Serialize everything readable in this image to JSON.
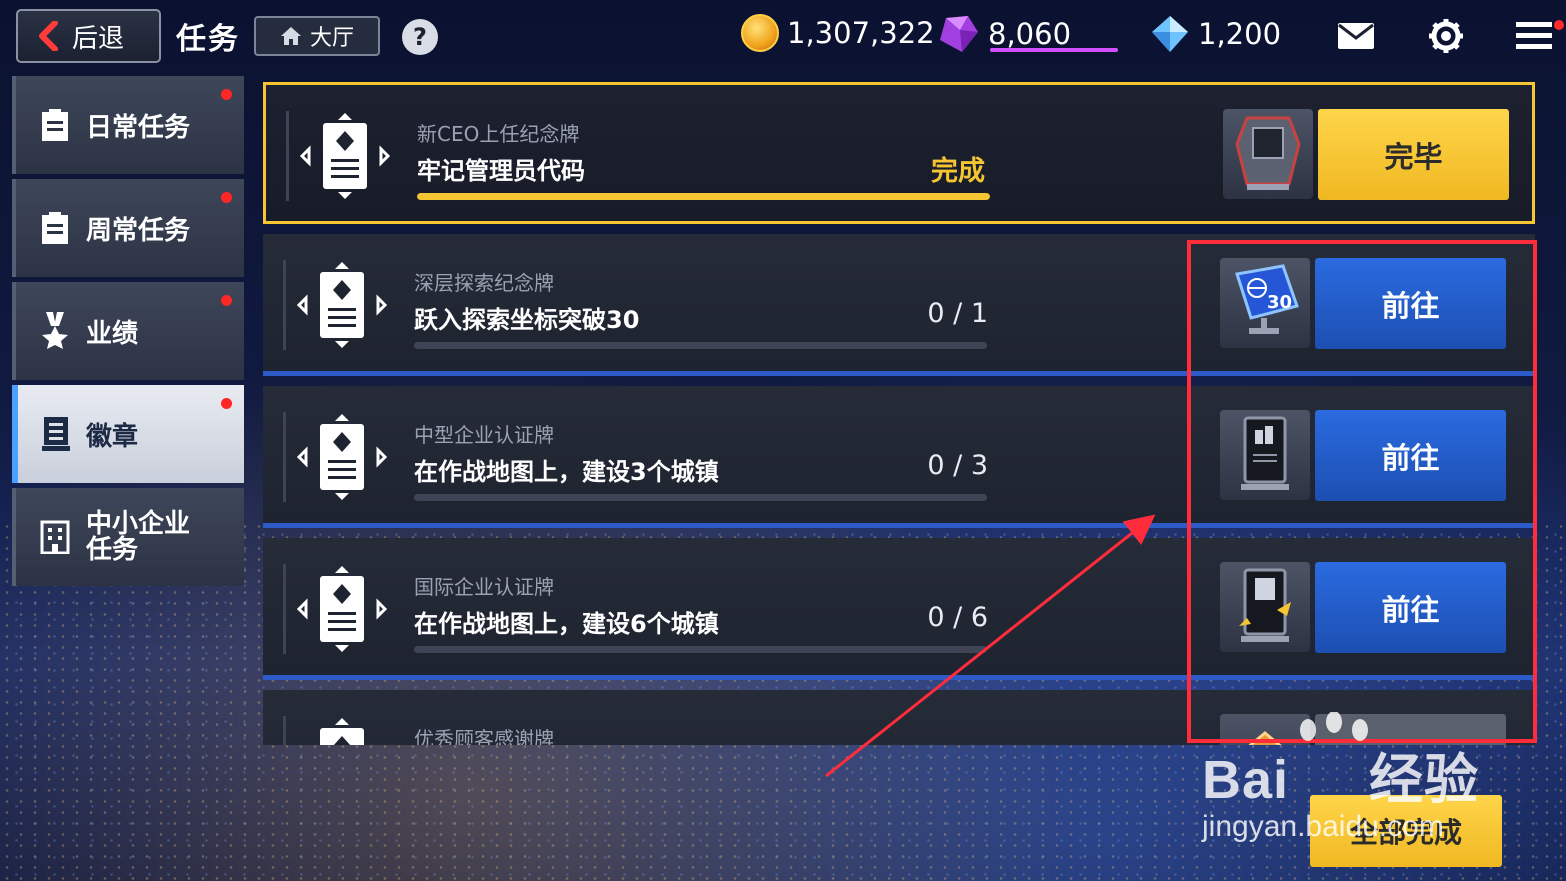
{
  "header": {
    "back_label": "后退",
    "title": "任务",
    "lobby_label": "大厅",
    "help_label": "?"
  },
  "currencies": {
    "gold": "1,307,322",
    "gems": "8,060",
    "diamonds": "1,200",
    "gold_icon": "gold-coin-icon",
    "gem_icon": "purple-gem-icon",
    "diamond_icon": "blue-diamond-icon"
  },
  "sidebar": {
    "items": [
      {
        "label": "日常任务",
        "icon": "clipboard-icon",
        "has_alert": true,
        "active": false
      },
      {
        "label": "周常任务",
        "icon": "clipboard-icon",
        "has_alert": true,
        "active": false
      },
      {
        "label": "业绩",
        "icon": "medal-icon",
        "has_alert": true,
        "active": false
      },
      {
        "label": "徽章",
        "icon": "badge-icon",
        "has_alert": true,
        "active": true
      },
      {
        "label_line1": "中小企业",
        "label_line2": "任务",
        "icon": "building-icon",
        "has_alert": false,
        "active": false
      }
    ]
  },
  "quests": [
    {
      "subtitle": "新CEO上任纪念牌",
      "title": "牢记管理员代码",
      "progress_text": "完成",
      "progress": 1.0,
      "action": "完毕",
      "state": "done",
      "badge_icon": "trophy-badge-icon"
    },
    {
      "subtitle": "深层探索纪念牌",
      "title": "跃入探索坐标突破30",
      "progress_text": "0 / 1",
      "progress": 0.0,
      "action": "前往",
      "state": "go",
      "badge_icon": "globe-30-badge-icon",
      "badge_text": "30"
    },
    {
      "subtitle": "中型企业认证牌",
      "title": "在作战地图上，建设3个城镇",
      "progress_text": "0 / 3",
      "progress": 0.0,
      "action": "前往",
      "state": "go",
      "badge_icon": "medium-company-plaque-icon"
    },
    {
      "subtitle": "国际企业认证牌",
      "title": "在作战地图上，建设6个城镇",
      "progress_text": "0 / 6",
      "progress": 0.0,
      "action": "前往",
      "state": "go",
      "badge_icon": "international-company-plaque-icon"
    },
    {
      "subtitle": "优秀顾客感谢牌",
      "title": "",
      "progress_text": "",
      "progress": 0.0,
      "action": "",
      "state": "partial",
      "badge_icon": "gold-plaque-icon"
    }
  ],
  "footer": {
    "complete_all_label": "全部完成"
  },
  "watermark": {
    "brand": "Bai",
    "brand_suffix": "经验",
    "url": "jingyan.baidu.com"
  },
  "colors": {
    "accent_gold": "#f5c631",
    "button_blue": "#2a6be0",
    "alert_red": "#ff2626",
    "annotation_red": "#ff2d3c"
  }
}
